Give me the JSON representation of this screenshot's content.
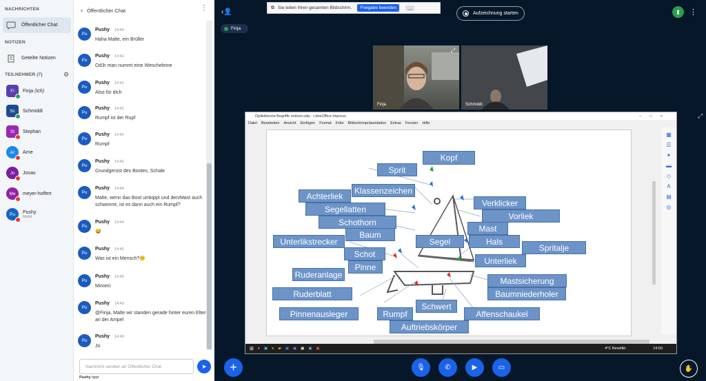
{
  "sidebar": {
    "messages_header": "NACHRICHTEN",
    "public_chat": "Öffentlicher Chat",
    "notes_header": "NOTIZEN",
    "shared_notes": "Geteilte Notizen",
    "participants_header": "TEILNEHMER (7)",
    "users": [
      {
        "initials": "Fi",
        "name": "Finja",
        "suffix": "(Ich)",
        "color": "#5b3fae",
        "mic": "#22a06b"
      },
      {
        "initials": "Sc",
        "name": "Schmiddi",
        "suffix": "",
        "color": "#1f4a8f",
        "mic": "#22a06b"
      },
      {
        "initials": "St",
        "name": "Stephan",
        "suffix": "",
        "color": "#9c27b0",
        "mic": "#e53935"
      },
      {
        "initials": "Ar",
        "name": "Arne",
        "suffix": "",
        "color": "#1e88e5",
        "mic": "#e53935"
      },
      {
        "initials": "Jo",
        "name": "Jonas",
        "suffix": "",
        "color": "#7b1fa2",
        "mic": "#e53935"
      },
      {
        "initials": "Me",
        "name": "meyer-hoffert",
        "suffix": "",
        "color": "#8e24aa",
        "mic": "#e53935"
      },
      {
        "initials": "Pu",
        "name": "Pushy",
        "suffix": "",
        "sub": "Mobil",
        "color": "#1565c0",
        "mic": "#e53935"
      }
    ]
  },
  "chat": {
    "title": "Öffentlicher Chat",
    "messages": [
      {
        "avatar": "Pu",
        "name": "Pushy",
        "time": "14:40",
        "text": "Haha Malte, ein Brüller"
      },
      {
        "avatar": "Pu",
        "name": "Pushy",
        "time": "14:42",
        "text": "Od3r man nummt eine Wescheleine"
      },
      {
        "avatar": "Pu",
        "name": "Pushy",
        "time": "14:41",
        "text": "Also für dich"
      },
      {
        "avatar": "Pu",
        "name": "Pushy",
        "time": "14:42",
        "text": "Rumpf ist der Rupf"
      },
      {
        "avatar": "Pu",
        "name": "Pushy",
        "time": "14:42",
        "text": "Rumpf"
      },
      {
        "avatar": "Pu",
        "name": "Pushy",
        "time": "14:42",
        "text": "Grundgerüst des Bootes, Schale"
      },
      {
        "avatar": "Pu",
        "name": "Pushy",
        "time": "14:44",
        "text": "Malte, wenn das Boot umkippt und dervMast auch schwimmt, ist es dann auch ein Rumpf?"
      },
      {
        "avatar": "Pu",
        "name": "Pushy",
        "time": "14:44",
        "text": "😅"
      },
      {
        "avatar": "Pu",
        "name": "Pushy",
        "time": "14:45",
        "text": "Was ist ein Mensch?😕"
      },
      {
        "avatar": "Pu",
        "name": "Pushy",
        "time": "14:46",
        "text": "Mimimi"
      },
      {
        "avatar": "Pu",
        "name": "Pushy",
        "time": "14:49",
        "text": "@Finja, Malte wir standen gerade hinter euren Eltern an der Ampel"
      },
      {
        "avatar": "Pu",
        "name": "Pushy",
        "time": "14:49",
        "text": "Jo"
      }
    ],
    "input_placeholder": "Nachricht senden an Öffentlicher Chat",
    "typing_name": "Pushy",
    "typing_text": "tippt"
  },
  "topbar": {
    "share_text": "Sie teilen Ihren gesamten Bildschirm.",
    "share_stop": "Freigabe beenden",
    "share_hide": "__",
    "record": "Aufzeichnung starten",
    "talking": "Finja"
  },
  "videos": [
    {
      "name": "Finja"
    },
    {
      "name": "Schmiddi"
    }
  ],
  "impress": {
    "title": "Optiktheorie Begriffe ordnen.odp - LibreOffice Impress",
    "menu": [
      "Datei",
      "Bearbeiten",
      "Ansicht",
      "Einfügen",
      "Format",
      "Folie",
      "Bildschirmpräsentation",
      "Extras",
      "Fenster",
      "Hilfe"
    ],
    "labels": [
      "Kopf",
      "Sprit",
      "Klassenzeichen",
      "Achterliek",
      "Segellatten",
      "Schothorn",
      "Baum",
      "Unterlikstrecker",
      "Schot",
      "Pinne",
      "Ruderanlage",
      "Ruderblatt",
      "Pinnenausleger",
      "Rumpf",
      "Schwert",
      "Auftriebskörper",
      "Segel",
      "Verklicker",
      "Vorliek",
      "Mast",
      "Hals",
      "Spritalje",
      "Unterliek",
      "Mastsicherung",
      "Baumniederholer",
      "Affenschaukel"
    ],
    "weather": "4°C  Bewölkt",
    "clock": "14:50"
  },
  "colors": {
    "accent": "#1a62e8",
    "label_bg": "#6c94c8",
    "dark_bg": "#06172a"
  }
}
